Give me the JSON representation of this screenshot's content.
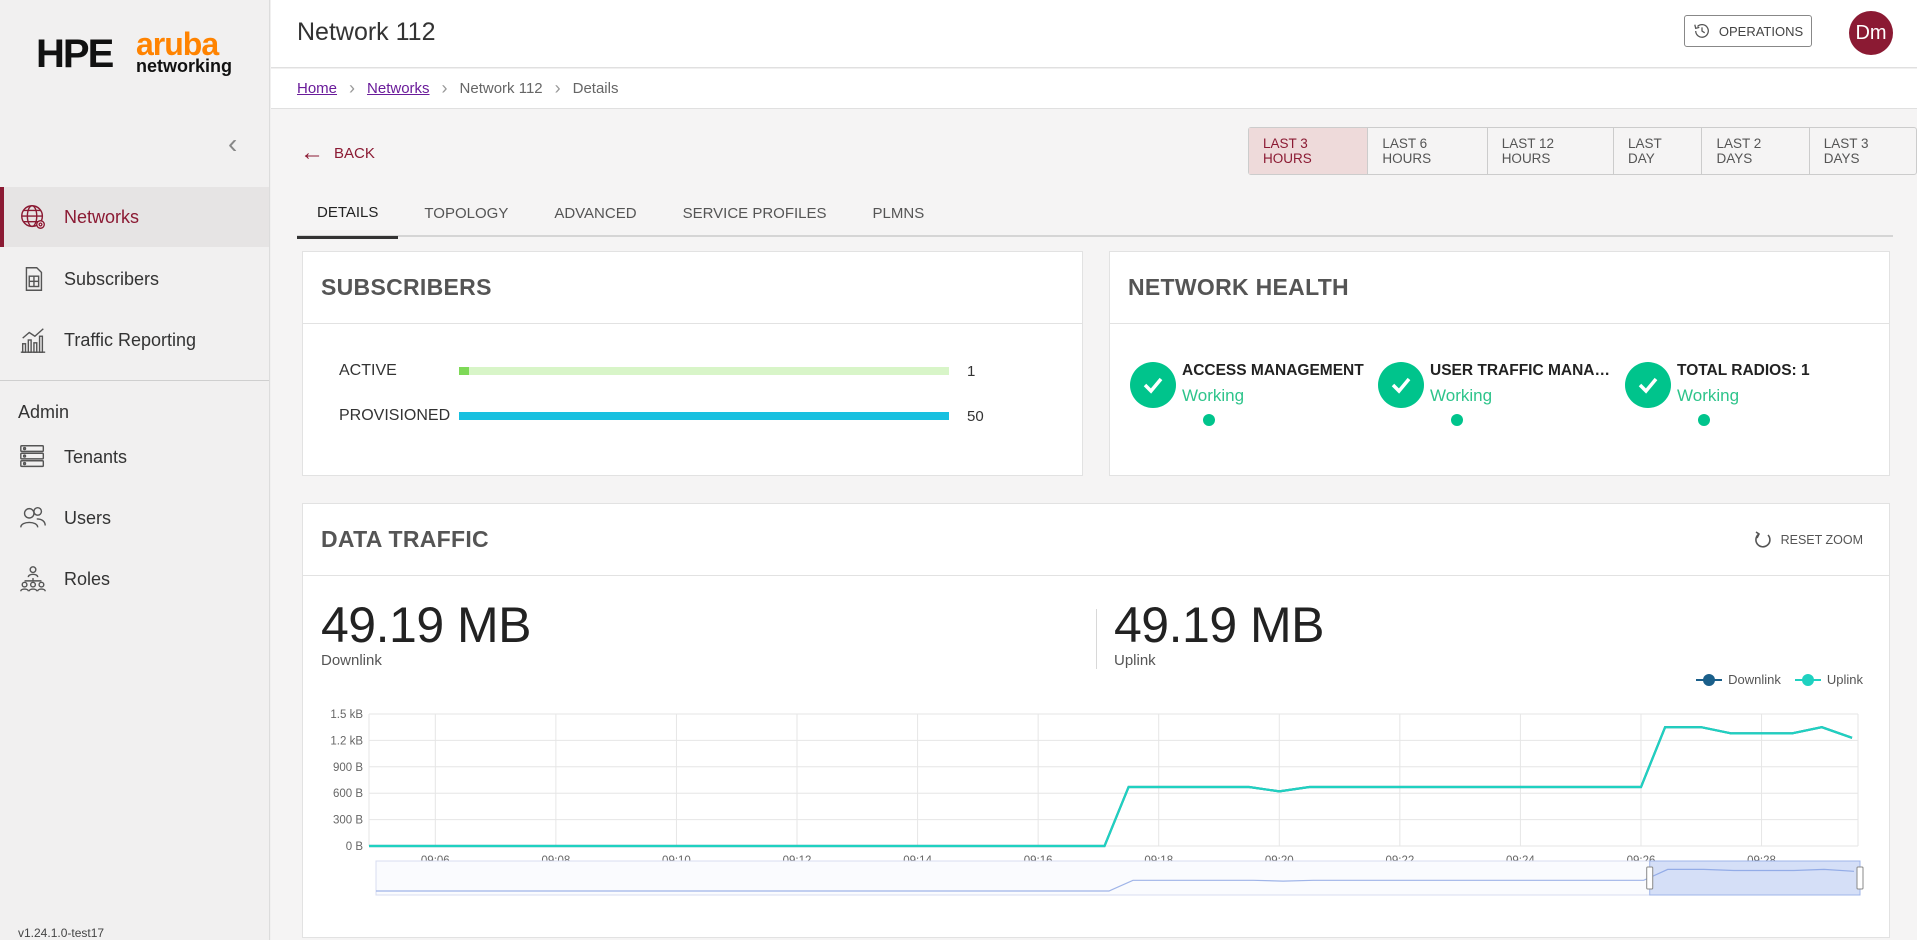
{
  "app": {
    "logo_hpe": "HPE",
    "logo_aruba": "aruba",
    "logo_networking": "networking",
    "version": "v1.24.1.0-test17"
  },
  "sidebar": {
    "items": [
      {
        "label": "Networks",
        "icon": "globe-icon",
        "active": true
      },
      {
        "label": "Subscribers",
        "icon": "sim-card-icon"
      },
      {
        "label": "Traffic Reporting",
        "icon": "chart-icon"
      }
    ],
    "admin_label": "Admin",
    "admin_items": [
      {
        "label": "Tenants",
        "icon": "server-icon"
      },
      {
        "label": "Users",
        "icon": "users-icon"
      },
      {
        "label": "Roles",
        "icon": "roles-icon"
      }
    ]
  },
  "header": {
    "title": "Network 112",
    "operations_label": "OPERATIONS",
    "avatar_initials": "Dm"
  },
  "breadcrumb": [
    "Home",
    "Networks",
    "Network 112",
    "Details"
  ],
  "back_label": "BACK",
  "time_ranges": [
    "LAST 3 HOURS",
    "LAST 6 HOURS",
    "LAST 12 HOURS",
    "LAST DAY",
    "LAST 2 DAYS",
    "LAST 3 DAYS"
  ],
  "active_range": "LAST 3 HOURS",
  "tabs": [
    "DETAILS",
    "TOPOLOGY",
    "ADVANCED",
    "SERVICE PROFILES",
    "PLMNS"
  ],
  "active_tab": "DETAILS",
  "subscribers": {
    "title": "SUBSCRIBERS",
    "rows": [
      {
        "label": "ACTIVE",
        "value": "1",
        "fraction": 0.02,
        "color": "#7ed957"
      },
      {
        "label": "PROVISIONED",
        "value": "50",
        "fraction": 1.0,
        "color": "#17c0e0"
      }
    ]
  },
  "network_health": {
    "title": "NETWORK HEALTH",
    "items": [
      {
        "title": "ACCESS MANAGEMENT",
        "status": "Working"
      },
      {
        "title": "USER TRAFFIC MANAGE...",
        "status": "Working"
      },
      {
        "title": "TOTAL RADIOS: 1",
        "status": "Working"
      }
    ]
  },
  "data_traffic": {
    "title": "DATA TRAFFIC",
    "reset_zoom_label": "RESET ZOOM",
    "downlink_value": "49.19 MB",
    "downlink_label": "Downlink",
    "uplink_value": "49.19 MB",
    "uplink_label": "Uplink"
  },
  "colors": {
    "brand": "#8b1a33",
    "downlink": "#1a5f8a",
    "uplink": "#1fd1c0",
    "success": "#00c48c"
  },
  "chart_data": {
    "type": "line",
    "xlabel": "",
    "ylabel": "",
    "x_ticks": [
      "09:06",
      "09:08",
      "09:10",
      "09:12",
      "09:14",
      "09:16",
      "09:18",
      "09:20",
      "09:22",
      "09:24",
      "09:26",
      "09:28"
    ],
    "y_ticks": [
      "0 B",
      "300 B",
      "600 B",
      "900 B",
      "1.2 kB",
      "1.5 kB"
    ],
    "ylim": [
      0,
      1500
    ],
    "legend": [
      "Downlink",
      "Uplink"
    ],
    "legend_position": "top-right",
    "grid": true,
    "series": [
      {
        "name": "Uplink",
        "x_minutes": [
          4.9,
          17.1,
          17.5,
          18.0,
          19.5,
          20.0,
          20.5,
          21.0,
          22.0,
          24.0,
          26.0,
          26.4,
          27.0,
          27.5,
          28.0,
          28.5,
          29.0,
          29.5
        ],
        "values": [
          0,
          0,
          670,
          670,
          670,
          620,
          670,
          670,
          670,
          670,
          670,
          1350,
          1350,
          1280,
          1280,
          1280,
          1350,
          1230
        ]
      },
      {
        "name": "Downlink",
        "x_minutes": [
          4.9,
          17.1,
          17.5,
          18.0,
          19.5,
          20.0,
          20.5,
          21.0,
          22.0,
          24.0,
          26.0,
          26.4,
          27.0,
          27.5,
          28.0,
          28.5,
          29.0,
          29.5
        ],
        "values": [
          0,
          0,
          670,
          670,
          670,
          620,
          670,
          670,
          670,
          670,
          670,
          1350,
          1350,
          1280,
          1280,
          1280,
          1350,
          1230
        ]
      }
    ]
  }
}
